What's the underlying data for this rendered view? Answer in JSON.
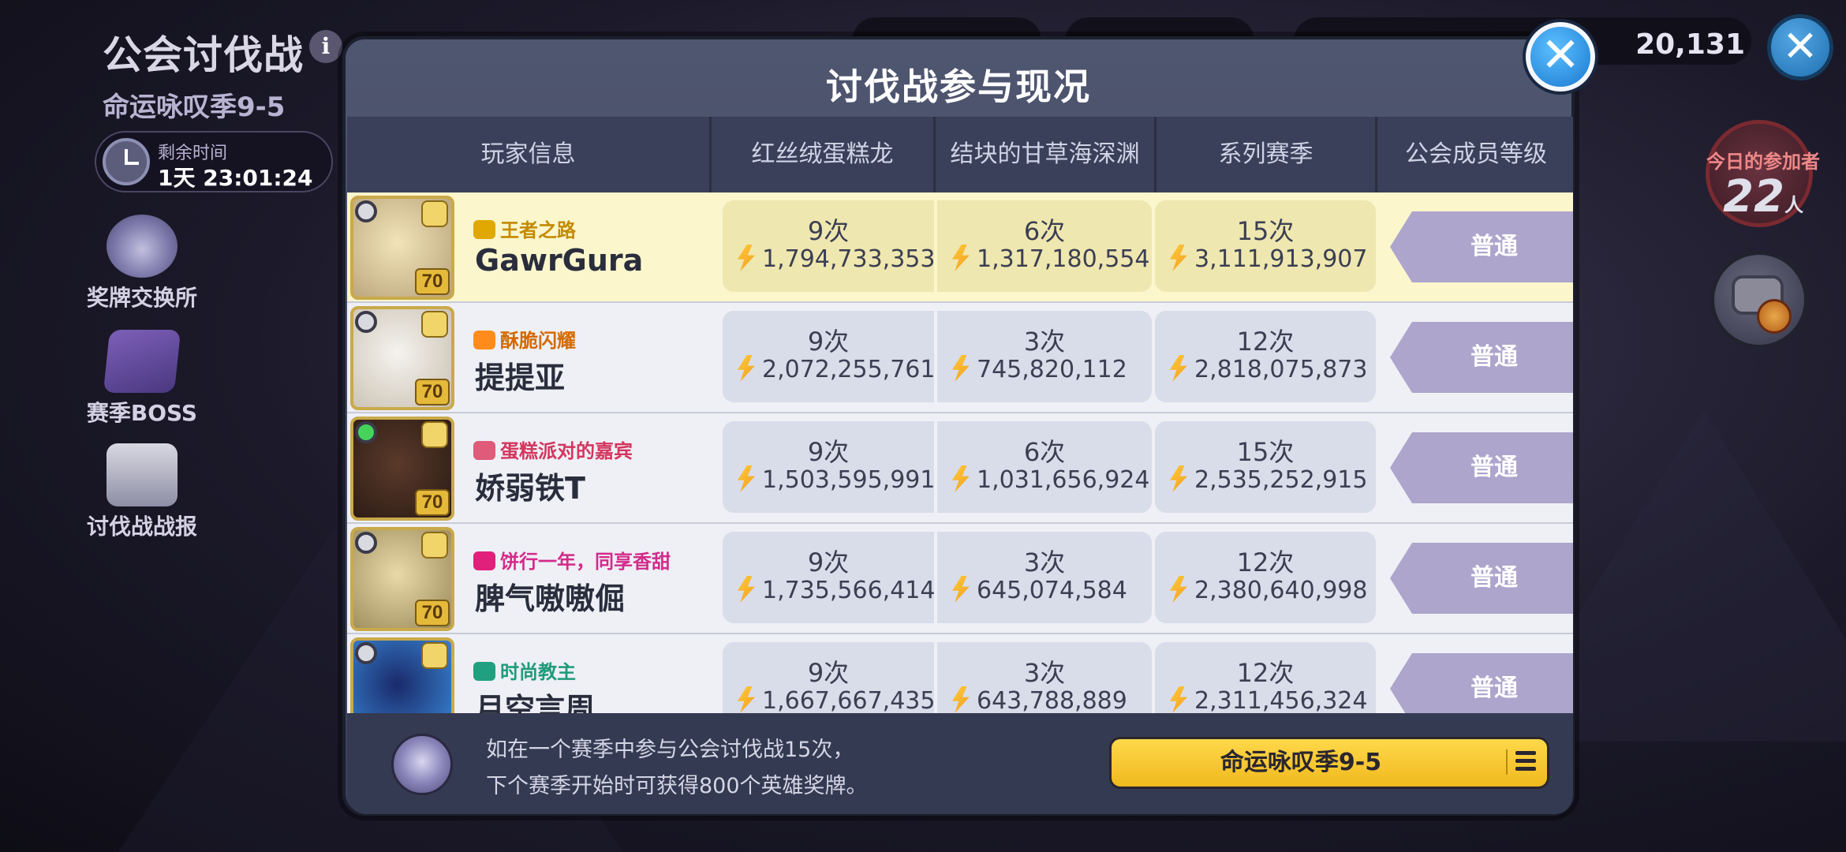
{
  "header": {
    "title": "公会讨伐战",
    "subtitle": "命运咏叹季9-5",
    "time_label": "剩余时间",
    "time_value": "1天 23:01:24"
  },
  "sidebar": {
    "items": [
      {
        "label": "奖牌交换所",
        "icon": "medal-icon"
      },
      {
        "label": "赛季BOSS",
        "icon": "boss-icon"
      },
      {
        "label": "讨伐战战报",
        "icon": "report-icon"
      }
    ]
  },
  "topbar": {
    "currency": "20,131"
  },
  "participants": {
    "label": "今日的参加者",
    "count": "22",
    "unit": "人"
  },
  "modal": {
    "title": "讨伐战参与现况",
    "columns": [
      "玩家信息",
      "红丝绒蛋糕龙",
      "结块的甘草海深渊",
      "系列赛季",
      "公会成员等级"
    ],
    "rows": [
      {
        "title": "王者之路",
        "title_color": "#c48a00",
        "name": "GawrGura",
        "level": "70",
        "online": false,
        "highlight": true,
        "a_count": "9次",
        "a_score": "1,794,733,353",
        "b_count": "6次",
        "b_score": "1,317,180,554",
        "c_count": "15次",
        "c_score": "3,111,913,907",
        "rank": "普通"
      },
      {
        "title": "酥脆闪耀",
        "title_color": "#d46a00",
        "name": "提提亚",
        "level": "70",
        "online": false,
        "highlight": false,
        "a_count": "9次",
        "a_score": "2,072,255,761",
        "b_count": "3次",
        "b_score": "745,820,112",
        "c_count": "12次",
        "c_score": "2,818,075,873",
        "rank": "普通"
      },
      {
        "title": "蛋糕派对的嘉宾",
        "title_color": "#d4365e",
        "name": "娇弱铁T",
        "level": "70",
        "online": true,
        "highlight": false,
        "a_count": "9次",
        "a_score": "1,503,595,991",
        "b_count": "6次",
        "b_score": "1,031,656,924",
        "c_count": "15次",
        "c_score": "2,535,252,915",
        "rank": "普通"
      },
      {
        "title": "饼行一年，同享香甜",
        "title_color": "#d42a8a",
        "name": "脾气嗷嗷倔",
        "level": "70",
        "online": false,
        "highlight": false,
        "a_count": "9次",
        "a_score": "1,735,566,414",
        "b_count": "3次",
        "b_score": "645,074,584",
        "c_count": "12次",
        "c_score": "2,380,640,998",
        "rank": "普通"
      },
      {
        "title": "时尚教主",
        "title_color": "#1f9a7a",
        "name": "月空言周",
        "level": "",
        "online": false,
        "highlight": false,
        "a_count": "9次",
        "a_score": "1,667,667,435",
        "b_count": "3次",
        "b_score": "643,788,889",
        "c_count": "12次",
        "c_score": "2,311,456,324",
        "rank": "普通"
      }
    ],
    "footer_text_1": "如在一个赛季中参与公会讨伐战15次，",
    "footer_text_2": "下个赛季开始时可获得800个英雄奖牌。",
    "season_button": "命运咏叹季9-5"
  },
  "colors": {
    "row_highlight": "#fbf6cc",
    "rank_badge": "#ada5cc",
    "season_button": "#f0b91e",
    "close_button": "#1a78d0"
  }
}
